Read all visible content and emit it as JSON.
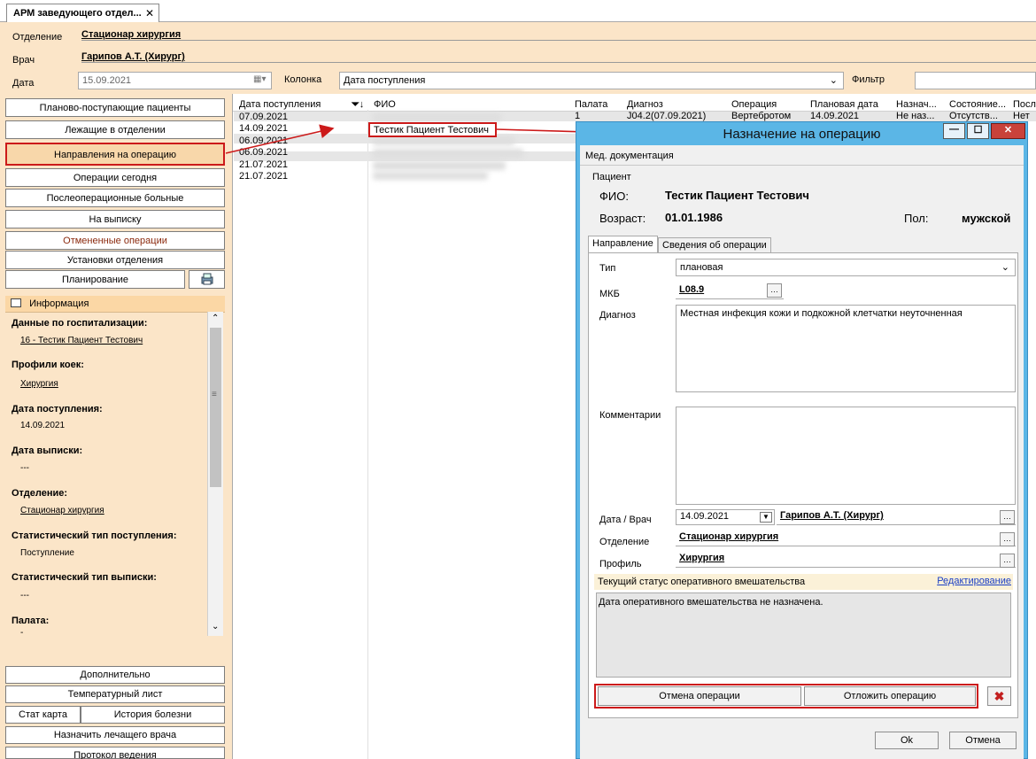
{
  "tab": {
    "title": "АРМ заведующего отдел...",
    "close": "✕"
  },
  "header": {
    "department_label": "Отделение",
    "department_value": "Стационар  хирургия",
    "doctor_label": "Врач",
    "doctor_value": "Гарипов А.Т. (Хирург)",
    "date_label": "Дата",
    "date_value": "15.09.2021",
    "column_label": "Колонка",
    "column_value": "Дата поступления",
    "filter_label": "Фильтр",
    "filter_value": ""
  },
  "nav": {
    "items": [
      "Планово-поступающие пациенты",
      "Лежащие в отделении",
      "Направления на операцию",
      "Операции сегодня",
      "Послеоперационные больные",
      "На выписку",
      "Отмененные операции",
      "Установки отделения",
      "Планирование"
    ],
    "active_index": 2
  },
  "info": {
    "title": "Информация",
    "hosp_label": "Данные по госпитализации:",
    "hosp_value": "16 - Тестик Пациент Тестович",
    "beds_label": "Профили коек:",
    "beds_value": "Хирургия",
    "admit_label": "Дата поступления:",
    "admit_value": "14.09.2021",
    "discharge_label": "Дата выписки:",
    "discharge_value": "---",
    "dept_label": "Отделение:",
    "dept_value": "Стационар  хирургия",
    "stat_in_label": "Статистический тип поступления:",
    "stat_in_value": "Поступление",
    "stat_out_label": "Статистический тип выписки:",
    "stat_out_value": "---",
    "ward_label": "Палата:",
    "ward_value": "-"
  },
  "bottom_nav": {
    "additional": "Дополнительно",
    "temp": "Температурный лист",
    "stat_card": "Стат карта",
    "history": "История болезни",
    "assign_doctor": "Назначить лечащего врача",
    "protocol": "Протокол ведения"
  },
  "grid": {
    "headers": [
      "Дата поступления",
      "ФИО",
      "Палата",
      "Диагноз",
      "Операция",
      "Плановая дата",
      "Назнач...",
      "Состояние...",
      "Посл"
    ],
    "dates": [
      "07.09.2021",
      "14.09.2021",
      "06.09.2021",
      "06.09.2021",
      "21.07.2021",
      "21.07.2021"
    ],
    "highlighted_fio": "Тестик Пациент Тестович",
    "row1_partial": [
      "1",
      "J04.2(07.09.2021)",
      "Вертебротом",
      "14.09.2021",
      "Не наз...",
      "Отсутств...",
      "Нет"
    ]
  },
  "dialog": {
    "title": "Назначение на операцию",
    "min": "—",
    "max": "☐",
    "close": "✕",
    "section": "Мед. документация",
    "patient_group": "Пациент",
    "fio_label": "ФИО:",
    "fio_value": "Тестик Пациент Тестович",
    "age_label": "Возраст:",
    "age_value": "01.01.1986",
    "sex_label": "Пол:",
    "sex_value": "мужской",
    "tab_direction": "Направление",
    "tab_info": "Сведения об операции",
    "type_label": "Тип",
    "type_value": "плановая",
    "mkb_label": "МКБ",
    "mkb_value": "L08.9",
    "diag_label": "Диагноз",
    "diag_value": "Местная инфекция кожи и подкожной клетчатки неуточненная",
    "comment_label": "Комментарии",
    "comment_value": "",
    "datedoc_label": "Дата / Врач",
    "datedoc_date": "14.09.2021",
    "datedoc_doctor": "Гарипов А.Т. (Хирург)",
    "dept_label": "Отделение",
    "dept_value": "Стационар  хирургия",
    "profile_label": "Профиль",
    "profile_value": "Хирургия",
    "status_title": "Текущий статус оперативного вмешательства",
    "edit_link": "Редактирование",
    "status_text": "Дата оперативного вмешательства не назначена.",
    "cancel_op": "Отмена операции",
    "postpone_op": "Отложить операцию",
    "ok": "Ok",
    "cancel": "Отмена"
  },
  "colors": {
    "accent": "#fbe5c8",
    "dialog_frame": "#5bb6e6",
    "annotation": "#cc1a1a"
  }
}
